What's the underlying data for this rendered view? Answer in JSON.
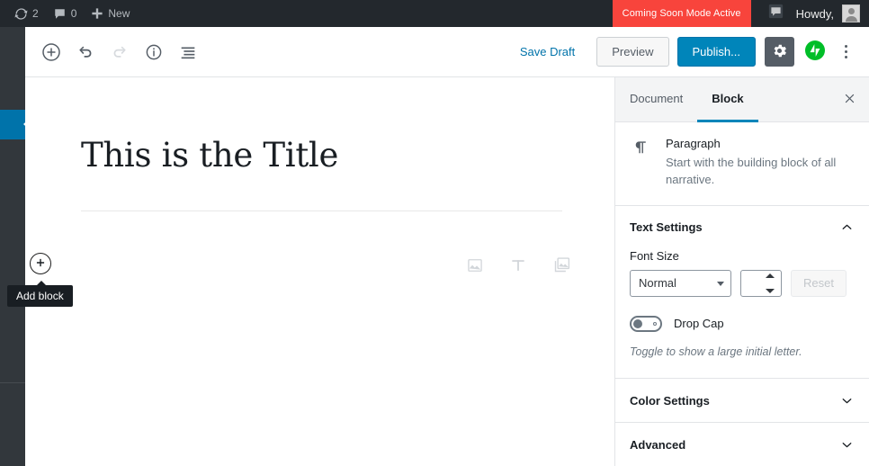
{
  "admin_bar": {
    "updates_icon": "wordpress-updates-icon",
    "updates_count": "2",
    "comments_icon": "comment-bubble-icon",
    "comments_count": "0",
    "new_icon": "plus-icon",
    "new_label": "New",
    "coming_soon_label": "Coming Soon Mode Active",
    "notification_icon": "comment-dark-icon",
    "howdy_label": "Howdy,",
    "avatar_icon": "user-avatar-icon",
    "bar_bg": "#23282d",
    "coming_soon_bg": "#f8443c"
  },
  "admin_sidebar": {
    "highlight_color": "#0073aa",
    "bg": "#32373c",
    "pointer_icon": "left-chevron-pointer-icon"
  },
  "editor_header": {
    "add_block_icon": "plus-circle-icon",
    "undo_icon": "undo-icon",
    "redo_icon": "redo-icon",
    "info_icon": "info-circle-icon",
    "block_nav_icon": "block-navigation-icon",
    "save_draft_label": "Save Draft",
    "preview_label": "Preview",
    "publish_label": "Publish...",
    "settings_gear_icon": "gear-icon",
    "jetpack_icon": "jetpack-icon",
    "jetpack_color": "#00be28",
    "more_menu_icon": "ellipsis-vertical-icon",
    "publish_bg": "#0085ba"
  },
  "content": {
    "post_title": "This is the Title",
    "placeholder_icons": [
      "image-icon",
      "text-icon",
      "gallery-icon"
    ],
    "add_block_icon": "plus-circle-icon",
    "tooltip_label": "Add block"
  },
  "sidebar": {
    "tabs": [
      {
        "label": "Document",
        "active": false
      },
      {
        "label": "Block",
        "active": true
      }
    ],
    "close_icon": "close-icon",
    "active_tab_color": "#0085ba",
    "block_card": {
      "icon": "paragraph-pilcrow-icon",
      "title": "Paragraph",
      "description": "Start with the building block of all narrative."
    },
    "text_settings": {
      "title": "Text Settings",
      "collapse_icon": "chevron-up-icon",
      "font_size_label": "Font Size",
      "font_size_value": "Normal",
      "font_size_custom_value": "",
      "spinner_icon": "spinner-arrows-icon",
      "reset_label": "Reset",
      "drop_cap_label": "Drop Cap",
      "drop_cap_on": false,
      "drop_cap_help": "Toggle to show a large initial letter."
    },
    "color_settings": {
      "title": "Color Settings",
      "expand_icon": "chevron-down-icon"
    },
    "advanced": {
      "title": "Advanced",
      "expand_icon": "chevron-down-icon"
    }
  }
}
